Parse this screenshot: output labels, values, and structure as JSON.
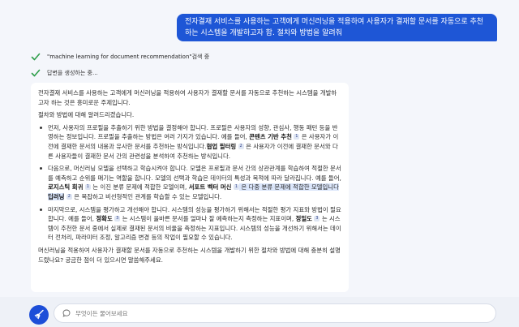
{
  "user_message": "전자결재 서비스를 사용하는 고객에게 머신러닝을 적용하여 사용자가 결재할 문서를 자동으로 추천하는 시스템을 개발하고자 함. 절차와 방법을 알려줘",
  "status": {
    "search_query": "\"machine learning for document recommendation\"",
    "search_suffix": " 검색 중",
    "generating": "답변을 생성하는 중..."
  },
  "answer": {
    "intro": "전자결재 서비스를 사용하는 고객에게 머신러닝을 적용하여 사용자가 결재할 문서를 자동으로 추천하는 시스템을 개발하고자 하는 것은 흥미로운 주제입니다.",
    "lead": "절차와 방법에 대해 알려드리겠습니다.",
    "b1": {
      "t1": "먼저, 사용자의 프로필을 추출하기 위한 방법을 결정해야 합니다. 프로필은 사용자의 성향, 관심사, 행동 패턴 등을 반영하는 정보입니다. 프로필을 추출하는 방법은 여러 가지가 있습니다. 예를 들어, ",
      "k1": "콘텐츠 기반 추천",
      "r1": "1",
      "t2": " 은 사용자가 이전에 결재한 문서의 내용과 유사한 문서를 추천하는 방식입니다.",
      "k2": "협업 필터링",
      "r2": "2",
      "t3": " 은 사용자가 이전에 결재한 문서와 다른 사용자들이 결재한 문서 간의 관련성을 분석하여 추천하는 방식입니다."
    },
    "b2": {
      "t1": "다음으로, 머신러닝 모델을 선택하고 학습시켜야 합니다. 모델은 프로필과 문서 간의 상관관계를 학습하여 적절한 문서를 예측하고 순위를 매기는 역할을 합니다. 모델의 선택과 학습은 데이터의 특성과 목적에 따라 달라집니다. 예를 들어, ",
      "k1": "로지스틱 회귀",
      "r1": "1",
      "t2": " 는 이진 분류 문제에 적합한 모델이며, ",
      "k2": "서포트 벡터 머신",
      "r2": "1",
      "t3": " 은 다중 분류 문제에 적합한 모델입니다",
      "k3": "딥러닝",
      "r3": "2",
      "t4": " 은 복잡하고 비선형적인 관계를 학습할 수 있는 모델입니다."
    },
    "b3": {
      "t1": "마지막으로, 시스템을 평가하고 개선해야 합니다. 시스템의 성능을 평가하기 위해서는 적절한 평가 지표와 방법이 필요합니다. 예를 들어, ",
      "k1": "정확도",
      "r1": "3",
      "t2": " 는 시스템이 올바른 문서를 얼마나 잘 예측하는지 측정하는 지표이며, ",
      "k2": "정밀도",
      "r2": "3",
      "t3": " 는 시스템이 추천한 문서 중에서 실제로 결재된 문서의 비율을 측정하는 지표입니다. 시스템의 성능을 개선하기 위해서는 데이터 전처리, 파라미터 조정, 알고리즘 변경 등의 작업이 필요할 수 있습니다."
    },
    "outro": "머신러닝을 적용하여 사용자가 결재할 문서를 자동으로 추천하는 시스템을 개발하기 위한 절차와 방법에 대해 충분히 설명드렸나요? 궁금한 점이 더 있으시면 말씀해주세요."
  },
  "input": {
    "placeholder": "무엇이든 물어보세요"
  },
  "colors": {
    "accent": "#1e56d6",
    "check": "#2e9e4a"
  },
  "icons": {
    "status": "check-icon",
    "new_topic": "broom-icon",
    "input": "chat-bubble-icon"
  }
}
